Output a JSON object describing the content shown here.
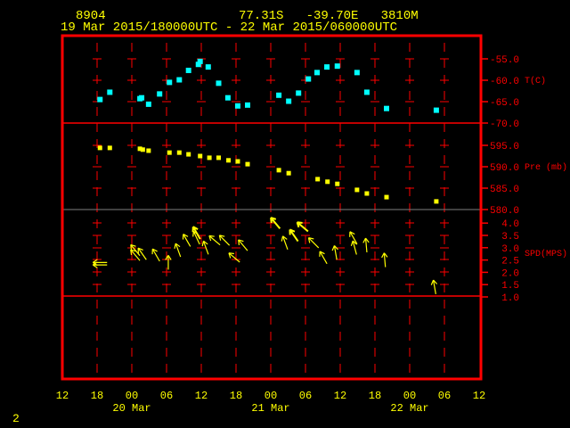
{
  "header": {
    "station_id": "8904",
    "location": "77.31S   -39.70E   3810M",
    "time_range": "19 Mar 2015/180000UTC - 22 Mar 2015/060000UTC"
  },
  "page_number": "2",
  "colors": {
    "frame": "#ff0000",
    "temperature": "#00ffff",
    "pressure": "#ffff00",
    "wind": "#ffff00",
    "text": "#ffff00",
    "midline": "#808080"
  },
  "chart_data": [
    {
      "type": "scatter",
      "name": "temperature",
      "ylabel": "T(C)",
      "ylim": [
        -70,
        -52.5
      ],
      "yticks": [
        "-55.0",
        "-60.0",
        "-65.0",
        "-70.0"
      ],
      "x_units": "hours since 19 Mar 12UTC",
      "x": [
        6.5,
        8.2,
        13.4,
        13.7,
        14.9,
        16.8,
        18.5,
        20.2,
        21.8,
        23.5,
        23.8,
        25.2,
        27.0,
        28.6,
        30.3,
        32.0,
        37.4,
        39.1,
        40.8,
        42.5,
        44.0,
        45.7,
        47.5,
        50.9,
        52.6,
        56.0,
        64.6
      ],
      "y": [
        -64.5,
        -62.8,
        -64.3,
        -64.1,
        -65.6,
        -63.2,
        -60.5,
        -59.9,
        -57.7,
        -56.3,
        -55.6,
        -56.9,
        -60.7,
        -64.1,
        -66.0,
        -65.8,
        -63.5,
        -64.9,
        -63.0,
        -59.7,
        -58.2,
        -56.9,
        -56.7,
        -58.2,
        -62.8,
        -66.6,
        -67.0
      ]
    },
    {
      "type": "scatter",
      "name": "pressure",
      "ylabel": "Pre (mb)",
      "ylim": [
        580,
        597.5
      ],
      "yticks": [
        "595.0",
        "590.0",
        "585.0",
        "580.0"
      ],
      "x_units": "hours since 19 Mar 12UTC",
      "x": [
        6.5,
        8.2,
        13.4,
        13.9,
        14.9,
        18.5,
        20.2,
        21.8,
        23.8,
        25.4,
        27.0,
        28.7,
        30.3,
        32.0,
        37.4,
        39.1,
        44.1,
        45.8,
        47.5,
        50.9,
        52.6,
        56.0,
        64.6
      ],
      "y": [
        594.4,
        594.4,
        594.2,
        594.0,
        593.75,
        593.3,
        593.3,
        592.9,
        592.5,
        592.1,
        592.1,
        591.5,
        591.25,
        590.6,
        589.2,
        588.5,
        587.1,
        586.5,
        586.0,
        584.6,
        583.75,
        582.9,
        581.9
      ]
    },
    {
      "type": "scatter",
      "name": "wind",
      "ylabel": "SPD(MPS)",
      "ylim": [
        1.0,
        4.5
      ],
      "yticks": [
        "4.0",
        "3.5",
        "3.0",
        "2.5",
        "2.0",
        "1.5",
        "1.0"
      ],
      "x_units": "hours since 19 Mar 12UTC",
      "x": [
        6.5,
        6.5,
        12.6,
        12.6,
        13.8,
        16.2,
        18.3,
        20.0,
        21.5,
        23.2,
        23.2,
        24.8,
        26.3,
        28.0,
        29.7,
        31.2,
        36.8,
        38.5,
        40.0,
        41.5,
        43.4,
        45.1,
        47.2,
        50.3,
        50.5,
        52.5,
        55.7,
        64.3
      ],
      "speed": [
        2.4,
        2.3,
        2.7,
        2.9,
        2.75,
        2.7,
        2.4,
        2.9,
        3.3,
        3.6,
        3.4,
        3.0,
        3.3,
        3.3,
        2.6,
        3.1,
        4.0,
        3.2,
        3.5,
        3.85,
        3.2,
        2.6,
        2.8,
        3.4,
        3.0,
        3.1,
        2.5,
        1.4
      ],
      "direction_deg": [
        90,
        90,
        140,
        140,
        145,
        150,
        180,
        160,
        150,
        150,
        155,
        160,
        130,
        135,
        130,
        140,
        140,
        160,
        145,
        130,
        135,
        150,
        170,
        150,
        165,
        175,
        175,
        170
      ]
    }
  ],
  "x_axis": {
    "hour_labels": [
      "12",
      "18",
      "00",
      "06",
      "12",
      "18",
      "00",
      "06",
      "12",
      "18",
      "00",
      "06",
      "12"
    ],
    "date_labels": [
      {
        "text": "20 Mar",
        "hour": 12
      },
      {
        "text": "21 Mar",
        "hour": 36
      },
      {
        "text": "22 Mar",
        "hour": 60
      }
    ],
    "range_hours": [
      0,
      72
    ]
  }
}
